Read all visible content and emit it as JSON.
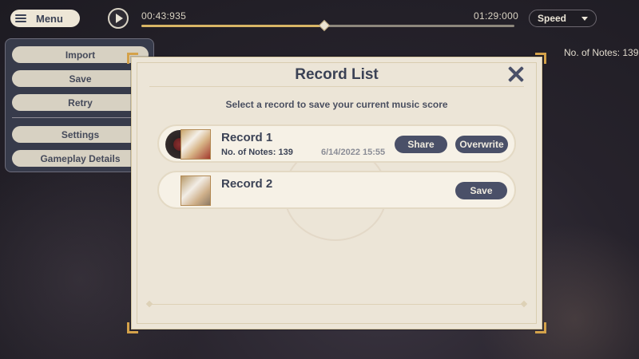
{
  "topbar": {
    "menu_label": "Menu",
    "time_current": "00:43:935",
    "time_total": "01:29:000",
    "progress": 0.49,
    "speed_label": "Speed"
  },
  "side_menu": {
    "items": [
      {
        "label": "Import"
      },
      {
        "label": "Save"
      },
      {
        "label": "Retry"
      },
      {
        "label": "Settings"
      },
      {
        "label": "Gameplay Details"
      }
    ]
  },
  "notes_count": "No. of Notes: 139",
  "modal": {
    "title": "Record List",
    "subtitle": "Select a record to save your current music score",
    "records": [
      {
        "name": "Record 1",
        "notes": "No. of Notes: 139",
        "date": "6/14/2022 15:55",
        "share_label": "Share",
        "overwrite_label": "Overwrite"
      },
      {
        "name": "Record 2",
        "save_label": "Save"
      }
    ]
  },
  "colors": {
    "accent": "#4a5068",
    "progress_fill": "#d8b565",
    "panel": "#ece5d7"
  }
}
